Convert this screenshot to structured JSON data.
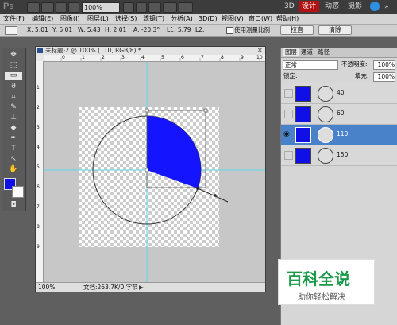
{
  "app": {
    "logo": "Ps",
    "zoom": "100%",
    "workspace": [
      "3D",
      "设计",
      "动感",
      "摄影"
    ],
    "active_workspace": "设计",
    "menu": [
      "文件(F)",
      "编辑(E)",
      "图像(I)",
      "图层(L)",
      "选择(S)",
      "滤镜(T)",
      "分析(A)",
      "3D(D)",
      "视图(V)",
      "窗口(W)",
      "帮助(H)"
    ]
  },
  "options_bar": {
    "x": "X: 5.01",
    "y": "Y: 5.01",
    "w": "W: 5.43",
    "h": "H: 2.01",
    "a": "A: -20.3°",
    "l1": "L1: 5.79",
    "l2": "L2:",
    "use_scale_label": "使用测量比例",
    "straighten_btn": "拉直",
    "clear_btn": "清除"
  },
  "document": {
    "tab_title": "未标题-2 @ 100% (110, RGB/8) *",
    "ruler_top": [
      "0",
      "1",
      "2",
      "3",
      "4",
      "5",
      "6",
      "7",
      "8",
      "9",
      "10"
    ],
    "ruler_left": [
      "1",
      "2",
      "3",
      "4",
      "5",
      "6",
      "7",
      "8",
      "9"
    ],
    "status_zoom": "100%",
    "status_doc": "文档:263.7K/0 字节"
  },
  "panels": {
    "tabs": [
      "图层",
      "通道",
      "路径"
    ],
    "blend_mode": "正常",
    "opacity_label": "不透明度:",
    "opacity_value": "100%",
    "lock_label": "锁定:",
    "fill_label": "填充:",
    "fill_value": "100%",
    "layers": [
      {
        "name": "40",
        "selected": false,
        "visible": false
      },
      {
        "name": "60",
        "selected": false,
        "visible": false
      },
      {
        "name": "110",
        "selected": true,
        "visible": true
      },
      {
        "name": "150",
        "selected": false,
        "visible": false
      }
    ]
  },
  "watermark": {
    "title": "百科全说",
    "subtitle": "助你轻松解决"
  },
  "colors": {
    "foreground": "#1010e6",
    "background": "#ffffff",
    "accent": "#b31212",
    "selected_layer": "#4a82c9",
    "sector_fill": "#1414ff"
  }
}
